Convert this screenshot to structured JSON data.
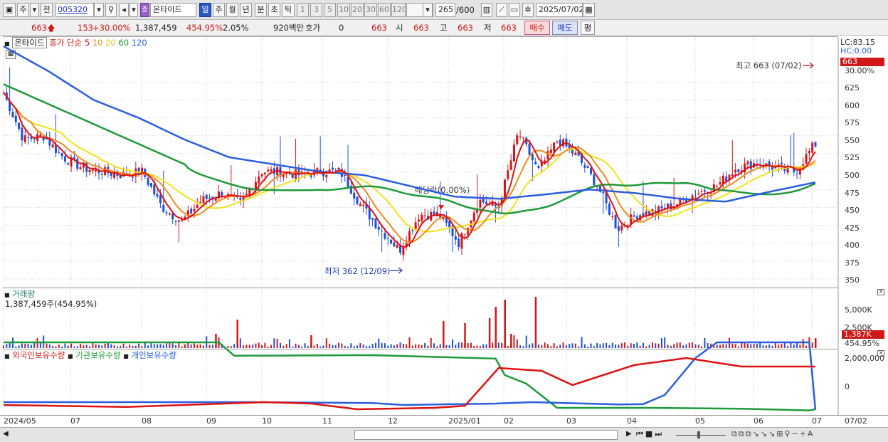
{
  "toolbar": {
    "btn_ju": "주",
    "btn_jeon": "전",
    "stock_code": "005320",
    "stock_name": "온타이드",
    "periods": [
      "일",
      "주",
      "월",
      "년",
      "분",
      "초",
      "틱"
    ],
    "intervals": [
      "1",
      "3",
      "5",
      "10",
      "20",
      "30",
      "60",
      "120"
    ],
    "count": "265",
    "count_total": "/600",
    "date": "2025/07/02"
  },
  "infobar": {
    "price": "663",
    "change": "153",
    "change_pct": "+30.00%",
    "volume": "1,387,459",
    "volume_ratio": "454.95%",
    "turnover": "2.05%",
    "amount": "920백만",
    "hoga_label": "호가",
    "hoga_val": "0",
    "hoga_price": "663",
    "open_label": "시",
    "open_val": "663",
    "high_label": "고",
    "high_val": "663",
    "low_label": "저",
    "low_val": "663",
    "buy_label": "매수",
    "sell_label": "매도",
    "eval_label": "평"
  },
  "price_panel": {
    "title": "온타이드",
    "legend_main": "종가 단순 5",
    "legend_ma": [
      "10",
      "20",
      "60",
      "120"
    ],
    "lc": "LC:83.15",
    "hc": "HC:0.00",
    "last_price": "663",
    "last_pct": "30.00%",
    "high_note": "최고 663 (07/02)",
    "low_note": "최저 362 (12/09)",
    "div_note": "배당락(0.00%)",
    "y_ticks": [
      "625",
      "600",
      "575",
      "550",
      "525",
      "500",
      "475",
      "450",
      "425",
      "400",
      "375",
      "350"
    ]
  },
  "volume_panel": {
    "title": "거래량",
    "value": "1,387,459주(454.95%)",
    "y_ticks": [
      "5,000K",
      "2,500K"
    ],
    "last_value": "1,387K",
    "last_pct": "454.95%"
  },
  "holding_panel": {
    "legend": [
      "외국인보유수량",
      "기관보유수량",
      "개인보유수량"
    ],
    "y_ticks": [
      "2,000,000",
      "0"
    ]
  },
  "x_axis": {
    "labels": [
      "2024/05",
      "07",
      "08",
      "09",
      "10",
      "11",
      "12",
      "2025/01",
      "02",
      "03",
      "04",
      "05",
      "06",
      "07"
    ],
    "right_label": "07/02"
  },
  "colors": {
    "up": "#d01818",
    "down": "#1e4fd8",
    "ma5": "#e01010",
    "ma10": "#f08a1a",
    "ma20": "#f0e21a",
    "ma60": "#1e9a3a",
    "ma120": "#2a5ee0"
  },
  "chart_data": {
    "type": "line",
    "title": "온타이드",
    "series": [
      {
        "name": "종가 단순 5",
        "values": [
          610,
          545,
          550,
          520,
          505,
          500,
          495,
          500,
          450,
          430,
          460,
          470,
          455,
          500,
          500,
          495,
          500,
          500,
          455,
          420,
          390,
          440,
          440,
          400,
          460,
          450,
          555,
          500,
          545,
          520,
          480,
          420,
          440,
          445,
          455,
          470,
          480,
          505,
          512,
          505,
          500,
          540
        ]
      },
      {
        "name": "120",
        "values": [
          675,
          640,
          600,
          575,
          545,
          520,
          510,
          500,
          495,
          480,
          465,
          462,
          468,
          475,
          470,
          462,
          458,
          472,
          485
        ]
      }
    ],
    "ylim": [
      340,
      680
    ]
  }
}
